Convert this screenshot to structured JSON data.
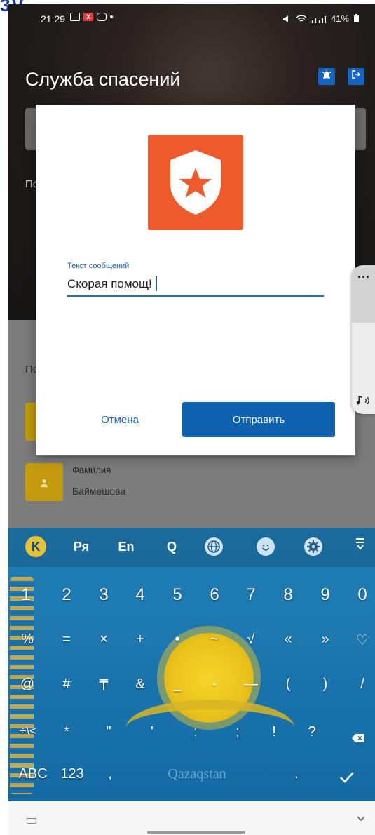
{
  "status_bar": {
    "time": "21:29",
    "battery": "41%"
  },
  "app": {
    "title": "Служба спасений",
    "hero_label_fragment": "По"
  },
  "list": {
    "section_fragment": "По",
    "items": [
      {
        "title": "",
        "subtitle": ""
      },
      {
        "title": "Фамилия",
        "subtitle": "Баймешова"
      }
    ]
  },
  "dialog": {
    "input_label": "Текст сообщений",
    "input_value": "Скорая помощ!",
    "cancel_label": "Отмена",
    "send_label": "Отправить",
    "logo_color": "#ee5a2b",
    "accent_color": "#0e62b0"
  },
  "keyboard": {
    "toolbar": [
      "K",
      "Ря",
      "En",
      "Q"
    ],
    "row_numbers": [
      "1",
      "2",
      "3",
      "4",
      "5",
      "6",
      "7",
      "8",
      "9",
      "0"
    ],
    "row_symbols1": [
      "%",
      "=",
      "×",
      "+",
      "•",
      "~",
      "√",
      "«",
      "»",
      "♡"
    ],
    "row_symbols2": [
      "@",
      "#",
      "₸",
      "&",
      "_",
      "-",
      "—",
      "(",
      ")",
      "/"
    ],
    "row_symbols3": [
      "÷\\<",
      "*",
      "\"",
      "'",
      ":",
      ";",
      "!",
      "?"
    ],
    "abc_label": "ABC",
    "num_label": "123",
    "comma_label": ",",
    "space_label": "Qazaqstan",
    "period_label": "."
  }
}
